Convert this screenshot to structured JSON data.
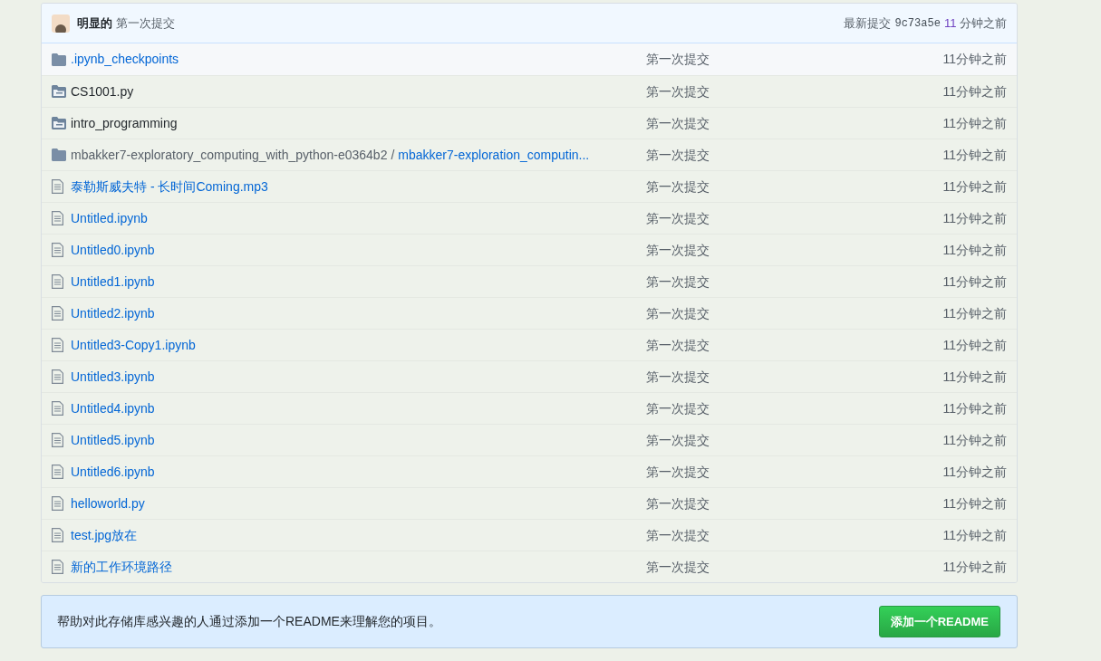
{
  "commit_bar": {
    "author": "明显的",
    "message": "第一次提交",
    "latest_label": "最新提交",
    "sha": "9c73a5e",
    "age_number": "11",
    "age_unit": "分钟之前"
  },
  "files": [
    {
      "kind": "dir",
      "name": ".ipynb_checkpoints",
      "message": "第一次提交",
      "age": "11分钟之前",
      "highlighted": true
    },
    {
      "kind": "symlink-dir",
      "name": "CS1001.py",
      "message": "第一次提交",
      "age": "11分钟之前",
      "highlighted": false
    },
    {
      "kind": "symlink-dir",
      "name": "intro_programming",
      "message": "第一次提交",
      "age": "11分钟之前",
      "highlighted": false
    },
    {
      "kind": "submodule",
      "name": "mbakker7-exploratory_computing_with_python-e0364b2",
      "separator": "/",
      "link": "mbakker7-exploration_computin...",
      "message": "第一次提交",
      "age": "11分钟之前",
      "highlighted": false
    },
    {
      "kind": "file",
      "name": "泰勒斯威夫特 - 长时间Coming.mp3",
      "message": "第一次提交",
      "age": "11分钟之前",
      "highlighted": false
    },
    {
      "kind": "file",
      "name": "Untitled.ipynb",
      "message": "第一次提交",
      "age": "11分钟之前",
      "highlighted": false
    },
    {
      "kind": "file",
      "name": "Untitled0.ipynb",
      "message": "第一次提交",
      "age": "11分钟之前",
      "highlighted": false
    },
    {
      "kind": "file",
      "name": "Untitled1.ipynb",
      "message": "第一次提交",
      "age": "11分钟之前",
      "highlighted": false
    },
    {
      "kind": "file",
      "name": "Untitled2.ipynb",
      "message": "第一次提交",
      "age": "11分钟之前",
      "highlighted": false
    },
    {
      "kind": "file",
      "name": "Untitled3-Copy1.ipynb",
      "message": "第一次提交",
      "age": "11分钟之前",
      "highlighted": false
    },
    {
      "kind": "file",
      "name": "Untitled3.ipynb",
      "message": "第一次提交",
      "age": "11分钟之前",
      "highlighted": false
    },
    {
      "kind": "file",
      "name": "Untitled4.ipynb",
      "message": "第一次提交",
      "age": "11分钟之前",
      "highlighted": false
    },
    {
      "kind": "file",
      "name": "Untitled5.ipynb",
      "message": "第一次提交",
      "age": "11分钟之前",
      "highlighted": false
    },
    {
      "kind": "file",
      "name": "Untitled6.ipynb",
      "message": "第一次提交",
      "age": "11分钟之前",
      "highlighted": false
    },
    {
      "kind": "file",
      "name": "helloworld.py",
      "message": "第一次提交",
      "age": "11分钟之前",
      "highlighted": false
    },
    {
      "kind": "file",
      "name": "test.jpg放在",
      "message": "第一次提交",
      "age": "11分钟之前",
      "highlighted": false
    },
    {
      "kind": "file",
      "name": "新的工作环境路径",
      "message": "第一次提交",
      "age": "11分钟之前",
      "highlighted": false
    }
  ],
  "readme_prompt": {
    "text": "帮助对此存储库感兴趣的人通过添加一个README来理解您的项目。",
    "button": "添加一个README"
  }
}
